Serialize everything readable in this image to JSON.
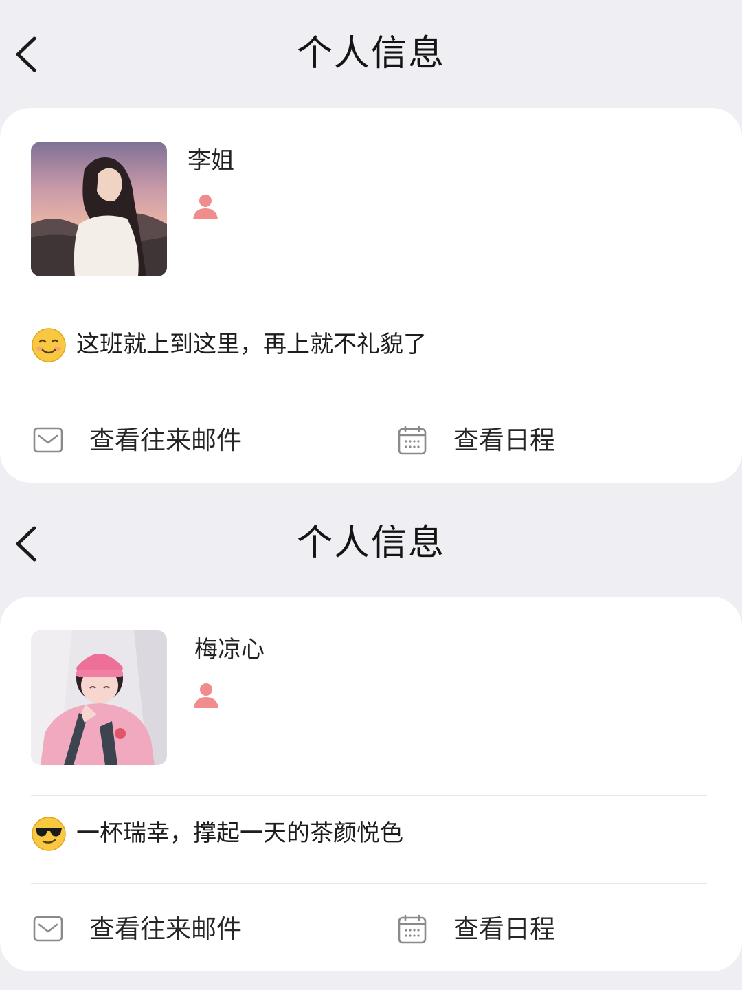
{
  "colors": {
    "page_background": "#eeeef3",
    "card_background": "#ffffff",
    "role_icon": "#f08c8c",
    "icon_gray": "#8a8a8a"
  },
  "profiles": [
    {
      "header": {
        "title": "个人信息",
        "back_icon": "chevron-left-icon"
      },
      "name": "李姐",
      "role_icon": "person-icon",
      "status": {
        "emoji": "smiling-face-icon",
        "text": "这班就上到这里，再上就不礼貌了"
      },
      "actions": [
        {
          "icon": "mail-icon",
          "label": "查看往来邮件"
        },
        {
          "icon": "calendar-icon",
          "label": "查看日程"
        }
      ]
    },
    {
      "header": {
        "title": "个人信息",
        "back_icon": "chevron-left-icon"
      },
      "name": "梅凉心",
      "role_icon": "person-icon",
      "status": {
        "emoji": "sunglasses-face-icon",
        "text": "一杯瑞幸，撑起一天的茶颜悦色"
      },
      "actions": [
        {
          "icon": "mail-icon",
          "label": "查看往来邮件"
        },
        {
          "icon": "calendar-icon",
          "label": "查看日程"
        }
      ]
    }
  ]
}
